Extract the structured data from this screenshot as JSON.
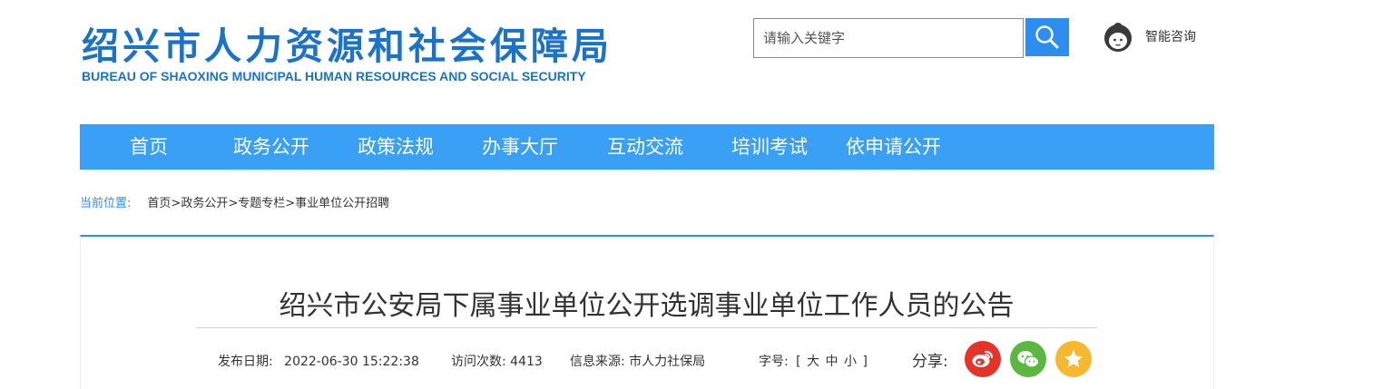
{
  "header": {
    "logo_cn": "绍兴市人力资源和社会保障局",
    "logo_en": "BUREAU OF SHAOXING MUNICIPAL HUMAN RESOURCES AND SOCIAL SECURITY",
    "search_placeholder": "请输入关键字",
    "consult_label": "智能咨询"
  },
  "nav": {
    "items": [
      "首页",
      "政务公开",
      "政策法规",
      "办事大厅",
      "互动交流",
      "培训考试",
      "依申请公开"
    ]
  },
  "breadcrumb": {
    "label": "当前位置:",
    "items": [
      "首页",
      "政务公开",
      "专题专栏",
      "事业单位公开招聘"
    ],
    "sep": ">"
  },
  "article": {
    "title": "绍兴市公安局下属事业单位公开选调事业单位工作人员的公告",
    "date_label": "发布日期:",
    "date": "2022-06-30 15:22:38",
    "visits_label": "访问次数:",
    "visits": "4413",
    "source_label": "信息来源:",
    "source": "市人力社保局",
    "font_label": "字号:",
    "font_open": "[",
    "font_large": "大",
    "font_medium": "中",
    "font_small": "小",
    "font_close": "]",
    "share_label": "分享:"
  },
  "colors": {
    "brand": "#1a73c8",
    "nav_bg": "#39a0f5",
    "weibo": "#e6332a",
    "wechat": "#58b83f",
    "favorite": "#f5b82e"
  }
}
